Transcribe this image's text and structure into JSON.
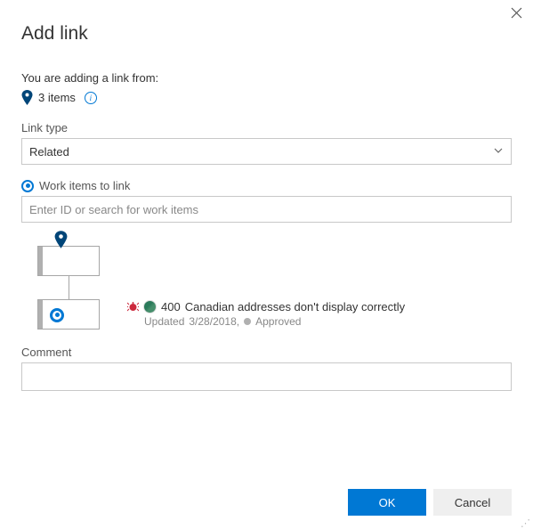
{
  "dialog": {
    "title": "Add link",
    "subtitle": "You are adding a link from:",
    "items_count": "3 items"
  },
  "link_type": {
    "label": "Link type",
    "value": "Related"
  },
  "work_items": {
    "label": "Work items to link",
    "placeholder": "Enter ID or search for work items"
  },
  "linked_item": {
    "id": "400",
    "title": "Canadian addresses don't display correctly",
    "updated_prefix": "Updated",
    "updated_date": "3/28/2018,",
    "state": "Approved"
  },
  "comment": {
    "label": "Comment"
  },
  "footer": {
    "ok": "OK",
    "cancel": "Cancel"
  }
}
